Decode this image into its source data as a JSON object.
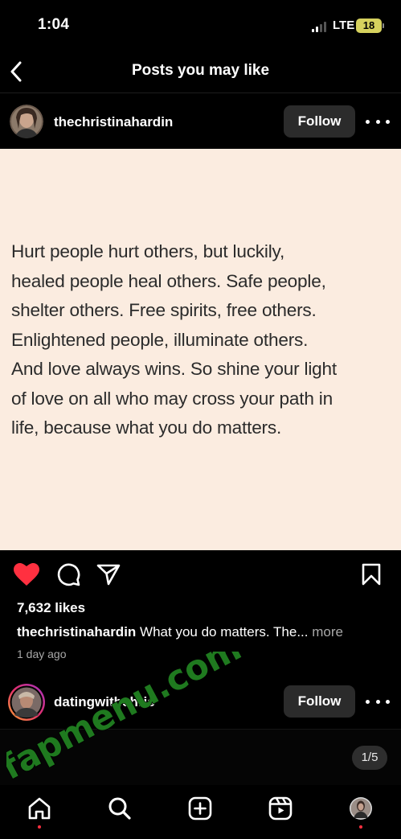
{
  "status_bar": {
    "time": "1:04",
    "network": "LTE",
    "battery": "18"
  },
  "header": {
    "title": "Posts you may like"
  },
  "post": {
    "username": "thechristinahardin",
    "follow_label": "Follow",
    "quote_lines": [
      "Hurt people hurt others, but luckily,",
      "healed people heal others. Safe people,",
      "shelter others. Free spirits, free others.",
      "Enlightened people, illuminate others.",
      "And love always wins. So shine your light",
      "of love on all who may cross your path in",
      "life, because what you do matters."
    ],
    "likes": "7,632 likes",
    "caption_user": "thechristinahardin",
    "caption_text": "What you do matters. The...",
    "caption_more": "more",
    "time_ago": "1 day ago"
  },
  "next_post": {
    "username": "datingwithchris",
    "follow_label": "Follow",
    "media_counter": "1/5"
  },
  "watermark": {
    "text": "fapmenu.com",
    "color": "#1f7a1f"
  },
  "colors": {
    "like": "#ff3040",
    "post_bg": "#fbece0",
    "follow_bg": "#2b2b2b"
  },
  "icons": {
    "back": "chevron-left-icon",
    "like": "heart-filled-icon",
    "comment": "comment-icon",
    "share": "send-icon",
    "save": "bookmark-icon",
    "more": "more-horizontal-icon",
    "home": "home-icon",
    "search": "search-icon",
    "create": "plus-square-icon",
    "reels": "reels-icon"
  }
}
